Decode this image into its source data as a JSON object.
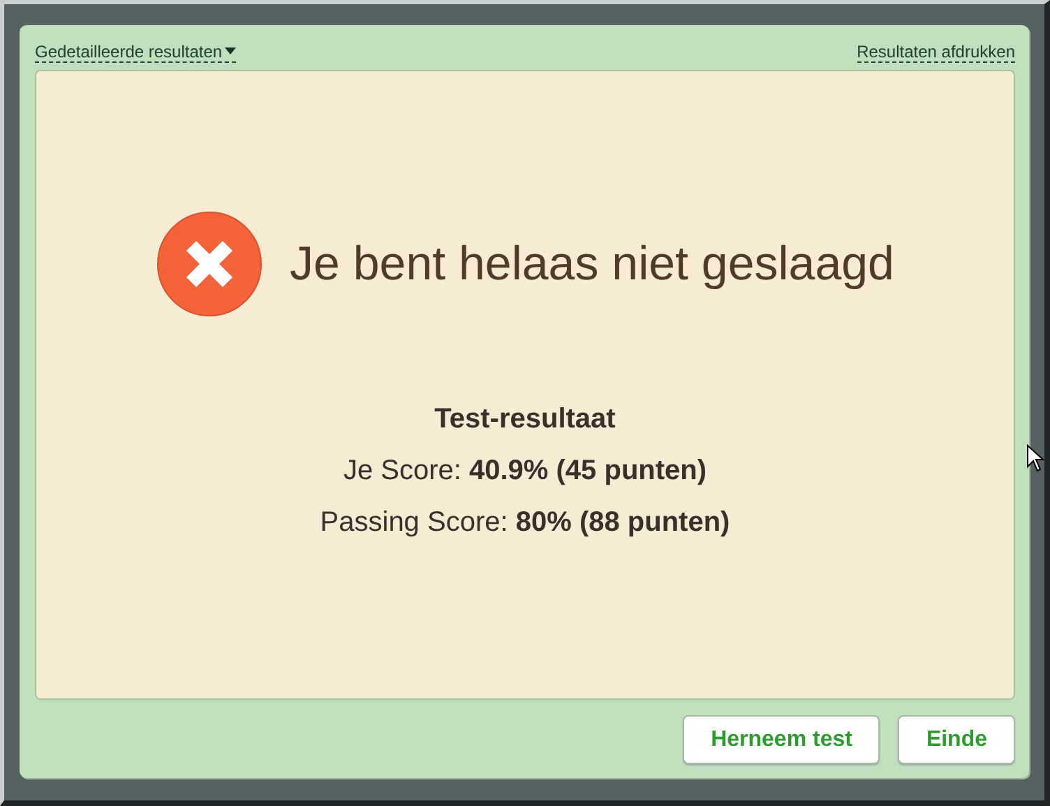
{
  "header": {
    "details_link": "Gedetailleerde resultaten",
    "print_link": "Resultaten afdrukken"
  },
  "result": {
    "passed": false,
    "message": "Je bent helaas niet geslaagd"
  },
  "scores": {
    "title": "Test-resultaat",
    "lines": [
      "Je Score: **40.9% (45 punten)**",
      "Passing Score: **80% (88 punten)**"
    ]
  },
  "buttons": [
    "Herneem test",
    "Einde"
  ]
}
